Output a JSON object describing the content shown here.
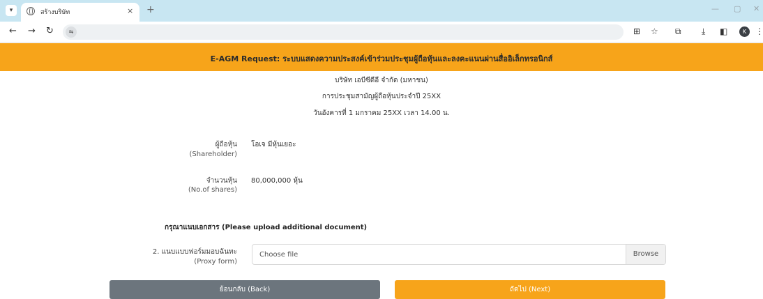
{
  "browser": {
    "tab_title": "สร้างบริษัท",
    "tab_close": "×",
    "new_tab": "+",
    "window_controls": {
      "minimize": "—",
      "maximize": "▢",
      "close": "✕"
    },
    "toolbar_icons": [
      "translate-icon",
      "star-icon",
      "extensions-icon",
      "downloads-icon",
      "sidepanel-icon",
      "profile-icon",
      "menu-icon"
    ],
    "profile_initial": "K"
  },
  "page": {
    "banner_title": "E-AGM Request: ระบบแสดงความประสงค์เข้าร่วมประชุมผู้ถือหุ้นและลงคะแนนผ่านสื่ออิเล็กทรอนิกส์",
    "company_name": "บริษัท เอบีซีดีอี จำกัด (มหาชน)",
    "meeting_name": "การประชุมสามัญผู้ถือหุ้นประจำปี 25XX",
    "meeting_date": "วันอังคารที่ 1 มกราคม 25XX เวลา 14.00 น.",
    "shareholder": {
      "label_th": "ผู้ถือหุ้น",
      "label_en": "(Shareholder)",
      "value": "โอเจ มีหุ้นเยอะ"
    },
    "shares": {
      "label_th": "จำนวนหุ้น",
      "label_en": "(No.of shares)",
      "value": "80,000,000 หุ้น"
    },
    "upload_section_title": "กรุณาแนบเอกสาร (Please upload additional document)",
    "proxy": {
      "label_th": "2. แนบแบบฟอร์มมอบฉันทะ",
      "label_en": "(Proxy form)",
      "placeholder": "Choose file",
      "browse_label": "Browse"
    },
    "back_label": "ย้อนกลับ (Back)",
    "next_label": "ถัดไป (Next)"
  },
  "colors": {
    "accent": "#f7a41a",
    "back_button": "#6c757d",
    "tabbar": "#c8e6f2"
  }
}
